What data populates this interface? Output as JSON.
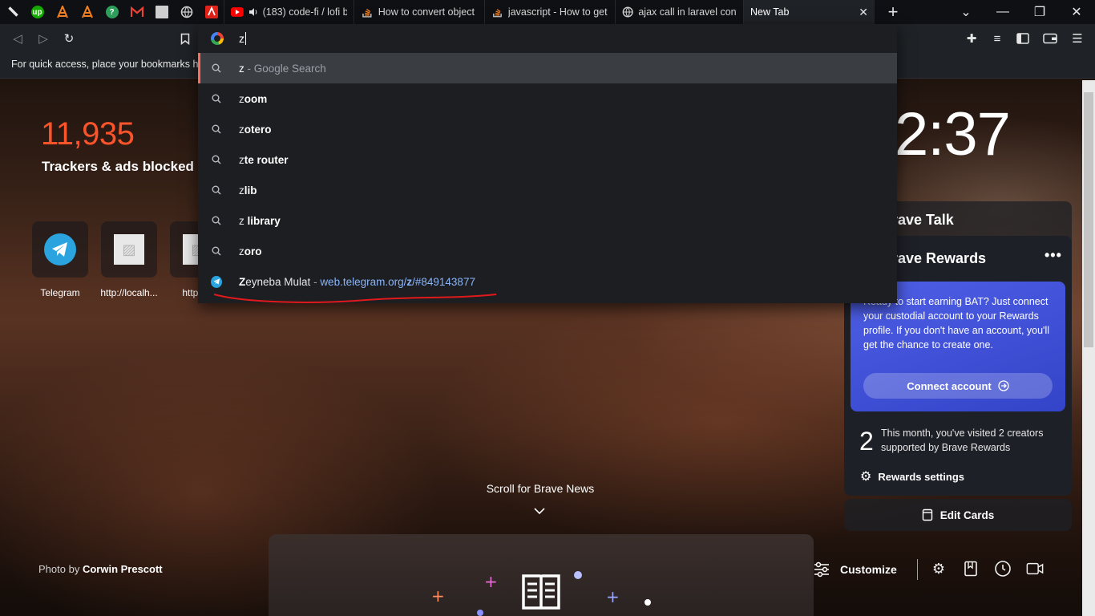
{
  "tabs": {
    "pinned": [
      {
        "name": "brave-icon",
        "color": "#e6e6e6"
      },
      {
        "name": "upwork-icon",
        "color": "#14a800"
      },
      {
        "name": "stat-icon-1",
        "color": "#f48024"
      },
      {
        "name": "stat-icon-2",
        "color": "#f48024"
      },
      {
        "name": "green-app-icon",
        "color": "#2e9e5b"
      },
      {
        "name": "gmail-icon",
        "color": "#ea4335"
      },
      {
        "name": "blank-page-icon",
        "color": "#cfcfcf"
      },
      {
        "name": "globe-icon",
        "color": "#cfcfcf"
      },
      {
        "name": "adobe-icon",
        "color": "#e2231a"
      }
    ],
    "items": [
      {
        "title": "(183) code-fi / lofi b",
        "icon": "youtube-icon",
        "audio": true
      },
      {
        "title": "How to convert object i",
        "icon": "stackoverflow-icon"
      },
      {
        "title": "javascript - How to get a",
        "icon": "stackoverflow-icon"
      },
      {
        "title": "ajax call in laravel contro",
        "icon": "globe-icon"
      },
      {
        "title": "New Tab",
        "icon": "none",
        "active": true
      }
    ],
    "new_tab": "+"
  },
  "bookmarks_bar": {
    "hint": "For quick access, place your bookmarks here"
  },
  "omnibox": {
    "value": "z",
    "suggestions": [
      {
        "bold": "z",
        "rest": " - Google Search",
        "type": "search",
        "selected": true
      },
      {
        "prefix": "z",
        "bold": "oom",
        "type": "search"
      },
      {
        "prefix": "z",
        "bold": "otero",
        "type": "search"
      },
      {
        "prefix": "z",
        "bold": "te router",
        "type": "search"
      },
      {
        "prefix": "z",
        "bold": "lib",
        "type": "search"
      },
      {
        "prefix": "z",
        "bold": " library",
        "type": "search"
      },
      {
        "prefix": "z",
        "bold": "oro",
        "type": "search"
      },
      {
        "bold": "Z",
        "rest": "eyneba Mulat",
        "sep": " - ",
        "url_pre": "web.telegram.org/",
        "url_bold": "z",
        "url_post": "/#849143877",
        "type": "history"
      }
    ]
  },
  "stats": {
    "count": "11,935",
    "label": "Trackers & ads blocked"
  },
  "top_sites": [
    {
      "label": "Telegram",
      "icon": "telegram-icon"
    },
    {
      "label": "http://localh...",
      "icon": "placeholder-image-icon"
    },
    {
      "label": "http://lo",
      "icon": "placeholder-image-icon"
    }
  ],
  "clock": "2:37",
  "brave_talk": {
    "title": "rave Talk"
  },
  "rewards": {
    "title": "rave Rewards",
    "more": "•••",
    "message": "Ready to start earning BAT? Just connect your custodial account to your Rewards profile. If you don't have an account, you'll get the chance to create one.",
    "connect_label": "Connect account",
    "visit_count": "2",
    "visit_text": "This month, you've visited 2 creators supported by Brave Rewards",
    "settings_label": "Rewards settings"
  },
  "edit_cards_label": "Edit Cards",
  "scroll_news": "Scroll for Brave News",
  "photo_credit": {
    "prefix": "Photo by",
    "author": "Corwin Prescott"
  },
  "customize_label": "Customize"
}
